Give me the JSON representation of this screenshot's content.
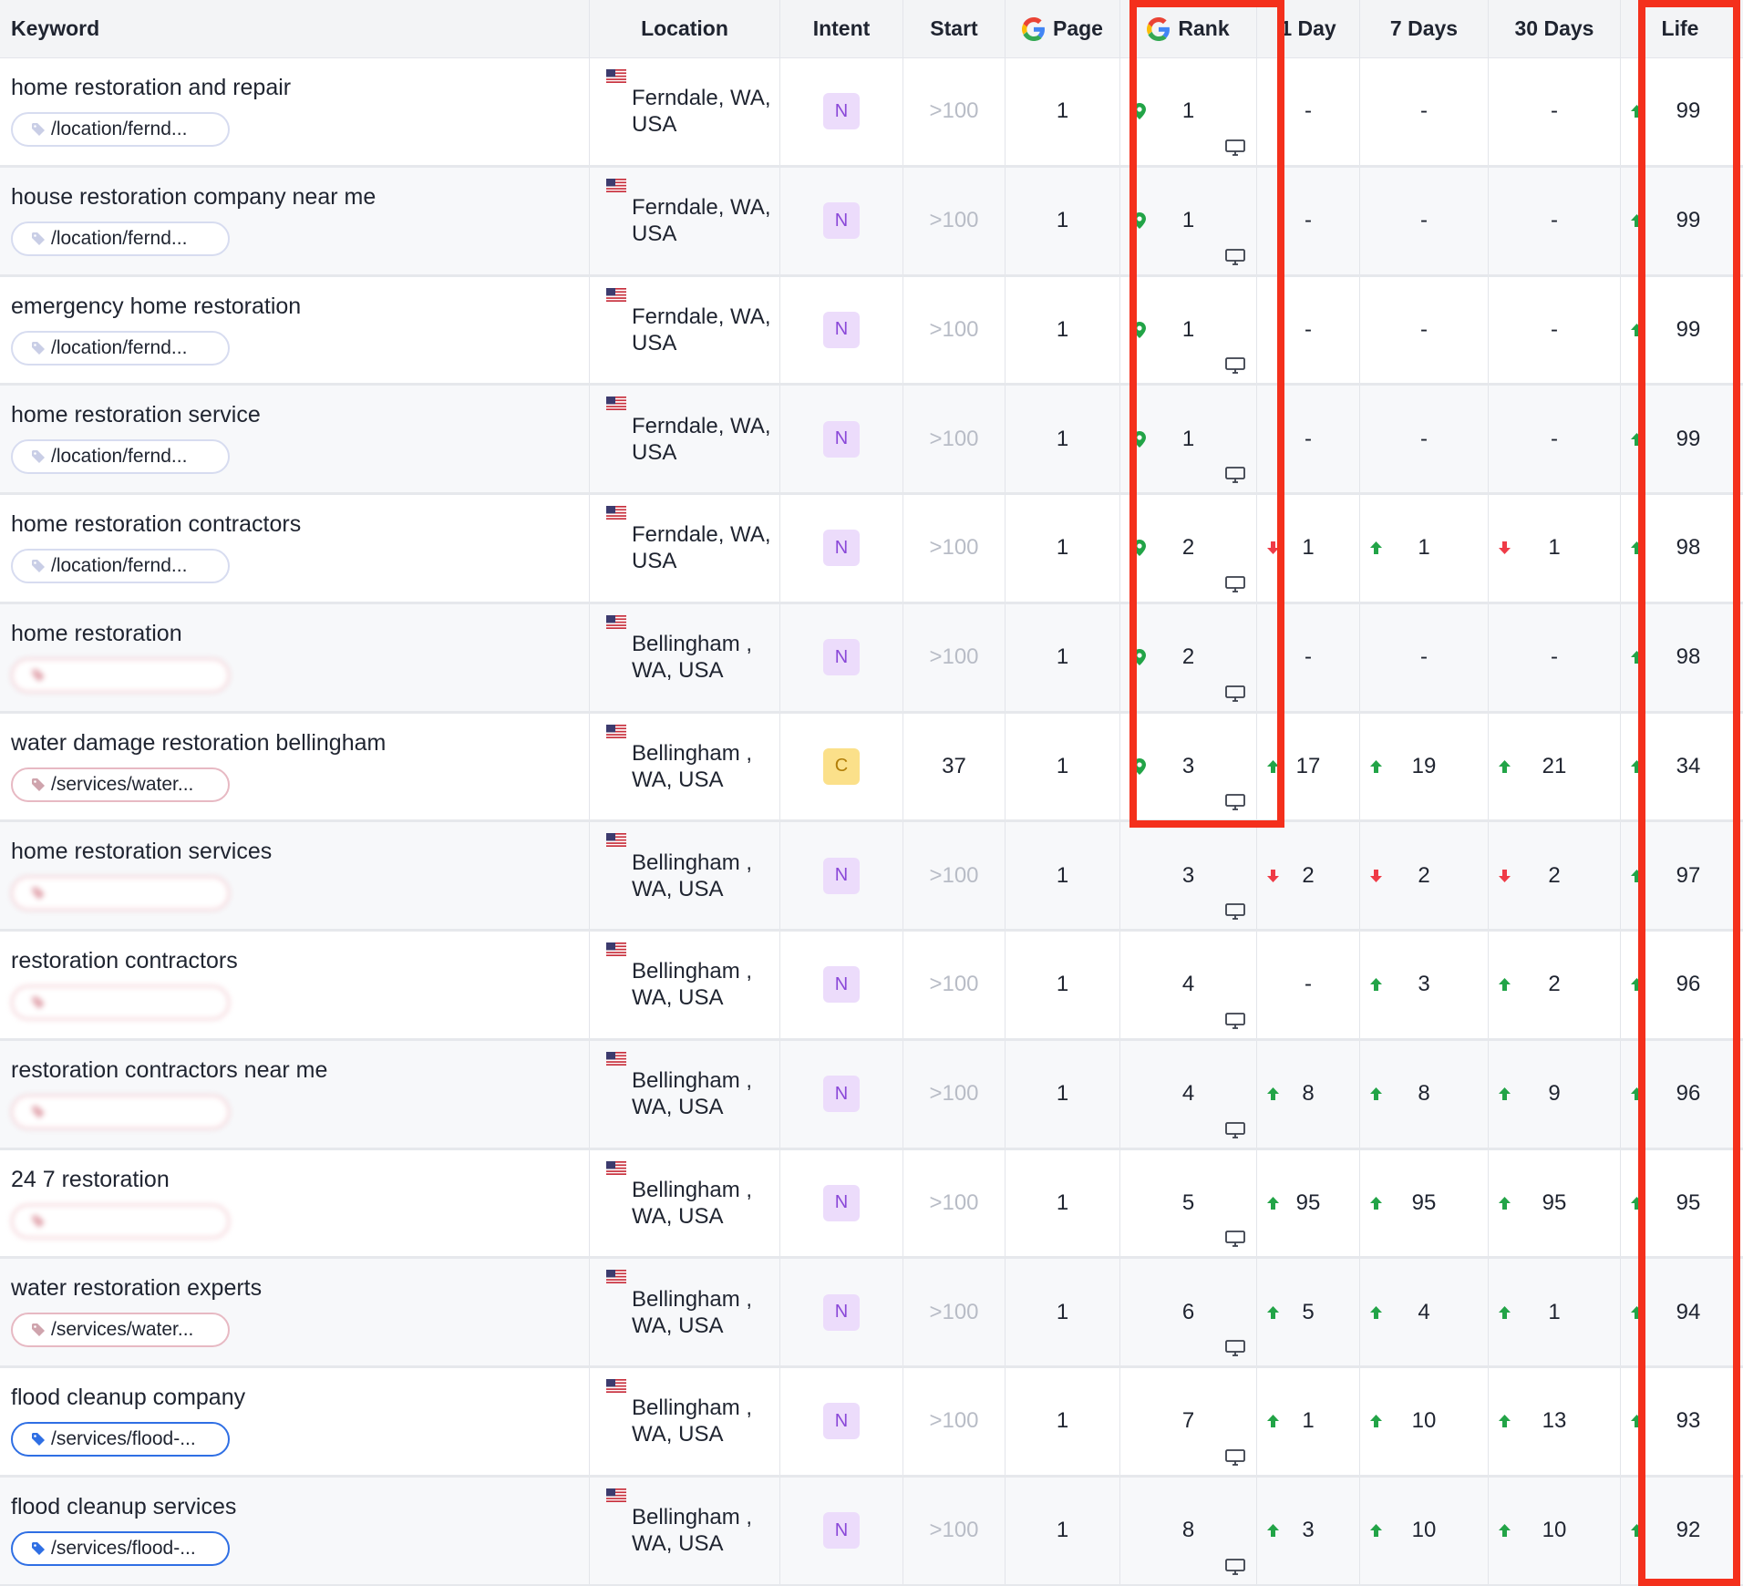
{
  "colors": {
    "highlight": "#f4301c",
    "up": "#22a447",
    "down": "#ef3b47",
    "intent_n_bg": "#ecdcfb",
    "intent_c_bg": "#fbe08a"
  },
  "headers": {
    "keyword": "Keyword",
    "location": "Location",
    "intent": "Intent",
    "start": "Start",
    "page": "Page",
    "rank": "Rank",
    "day1": "1 Day",
    "day7": "7 Days",
    "day30": "30 Days",
    "life": "Life"
  },
  "rows": [
    {
      "keyword": "home restoration and repair",
      "tag": "/location/fernd...",
      "tag_style": "plain",
      "location": "Ferndale, WA, USA",
      "intent": "N",
      "start": ">100",
      "page": "1",
      "rank": "1",
      "pin": true,
      "d1": "-",
      "d1_dir": "none",
      "d7": "-",
      "d7_dir": "none",
      "d30": "-",
      "d30_dir": "none",
      "life": "99",
      "life_dir": "up"
    },
    {
      "keyword": "house restoration company near me",
      "tag": "/location/fernd...",
      "tag_style": "plain",
      "location": "Ferndale, WA, USA",
      "intent": "N",
      "start": ">100",
      "page": "1",
      "rank": "1",
      "pin": true,
      "d1": "-",
      "d1_dir": "none",
      "d7": "-",
      "d7_dir": "none",
      "d30": "-",
      "d30_dir": "none",
      "life": "99",
      "life_dir": "up"
    },
    {
      "keyword": "emergency home restoration",
      "tag": "/location/fernd...",
      "tag_style": "plain",
      "location": "Ferndale, WA, USA",
      "intent": "N",
      "start": ">100",
      "page": "1",
      "rank": "1",
      "pin": true,
      "d1": "-",
      "d1_dir": "none",
      "d7": "-",
      "d7_dir": "none",
      "d30": "-",
      "d30_dir": "none",
      "life": "99",
      "life_dir": "up"
    },
    {
      "keyword": "home restoration service",
      "tag": "/location/fernd...",
      "tag_style": "plain",
      "location": "Ferndale, WA, USA",
      "intent": "N",
      "start": ">100",
      "page": "1",
      "rank": "1",
      "pin": true,
      "d1": "-",
      "d1_dir": "none",
      "d7": "-",
      "d7_dir": "none",
      "d30": "-",
      "d30_dir": "none",
      "life": "99",
      "life_dir": "up"
    },
    {
      "keyword": "home restoration contractors",
      "tag": "/location/fernd...",
      "tag_style": "plain",
      "location": "Ferndale, WA, USA",
      "intent": "N",
      "start": ">100",
      "page": "1",
      "rank": "2",
      "pin": true,
      "d1": "1",
      "d1_dir": "down",
      "d7": "1",
      "d7_dir": "up",
      "d30": "1",
      "d30_dir": "down",
      "life": "98",
      "life_dir": "up"
    },
    {
      "keyword": "home restoration",
      "tag": "",
      "tag_style": "blurred",
      "location": "Bellingham , WA, USA",
      "intent": "N",
      "start": ">100",
      "page": "1",
      "rank": "2",
      "pin": true,
      "d1": "-",
      "d1_dir": "none",
      "d7": "-",
      "d7_dir": "none",
      "d30": "-",
      "d30_dir": "none",
      "life": "98",
      "life_dir": "up"
    },
    {
      "keyword": "water damage restoration bellingham",
      "tag": "/services/water...",
      "tag_style": "pink",
      "location": "Bellingham , WA, USA",
      "intent": "C",
      "start": "37",
      "page": "1",
      "rank": "3",
      "pin": true,
      "d1": "17",
      "d1_dir": "up",
      "d7": "19",
      "d7_dir": "up",
      "d30": "21",
      "d30_dir": "up",
      "life": "34",
      "life_dir": "up"
    },
    {
      "keyword": "home restoration services",
      "tag": "",
      "tag_style": "blurred",
      "location": "Bellingham , WA, USA",
      "intent": "N",
      "start": ">100",
      "page": "1",
      "rank": "3",
      "pin": false,
      "d1": "2",
      "d1_dir": "down",
      "d7": "2",
      "d7_dir": "down",
      "d30": "2",
      "d30_dir": "down",
      "life": "97",
      "life_dir": "up"
    },
    {
      "keyword": "restoration contractors",
      "tag": "",
      "tag_style": "blurred",
      "location": "Bellingham , WA, USA",
      "intent": "N",
      "start": ">100",
      "page": "1",
      "rank": "4",
      "pin": false,
      "d1": "-",
      "d1_dir": "none",
      "d7": "3",
      "d7_dir": "up",
      "d30": "2",
      "d30_dir": "up",
      "life": "96",
      "life_dir": "up"
    },
    {
      "keyword": "restoration contractors near me",
      "tag": "",
      "tag_style": "blurred",
      "location": "Bellingham , WA, USA",
      "intent": "N",
      "start": ">100",
      "page": "1",
      "rank": "4",
      "pin": false,
      "d1": "8",
      "d1_dir": "up",
      "d7": "8",
      "d7_dir": "up",
      "d30": "9",
      "d30_dir": "up",
      "life": "96",
      "life_dir": "up"
    },
    {
      "keyword": "24 7 restoration",
      "tag": "",
      "tag_style": "blurred",
      "location": "Bellingham , WA, USA",
      "intent": "N",
      "start": ">100",
      "page": "1",
      "rank": "5",
      "pin": false,
      "d1": "95",
      "d1_dir": "up",
      "d7": "95",
      "d7_dir": "up",
      "d30": "95",
      "d30_dir": "up",
      "life": "95",
      "life_dir": "up"
    },
    {
      "keyword": "water restoration experts",
      "tag": "/services/water...",
      "tag_style": "pink",
      "location": "Bellingham , WA, USA",
      "intent": "N",
      "start": ">100",
      "page": "1",
      "rank": "6",
      "pin": false,
      "d1": "5",
      "d1_dir": "up",
      "d7": "4",
      "d7_dir": "up",
      "d30": "1",
      "d30_dir": "up",
      "life": "94",
      "life_dir": "up"
    },
    {
      "keyword": "flood cleanup company",
      "tag": "/services/flood-...",
      "tag_style": "blue",
      "location": "Bellingham , WA, USA",
      "intent": "N",
      "start": ">100",
      "page": "1",
      "rank": "7",
      "pin": false,
      "d1": "1",
      "d1_dir": "up",
      "d7": "10",
      "d7_dir": "up",
      "d30": "13",
      "d30_dir": "up",
      "life": "93",
      "life_dir": "up"
    },
    {
      "keyword": "flood cleanup services",
      "tag": "/services/flood-...",
      "tag_style": "blue",
      "location": "Bellingham , WA, USA",
      "intent": "N",
      "start": ">100",
      "page": "1",
      "rank": "8",
      "pin": false,
      "d1": "3",
      "d1_dir": "up",
      "d7": "10",
      "d7_dir": "up",
      "d30": "10",
      "d30_dir": "up",
      "life": "92",
      "life_dir": "up"
    }
  ]
}
